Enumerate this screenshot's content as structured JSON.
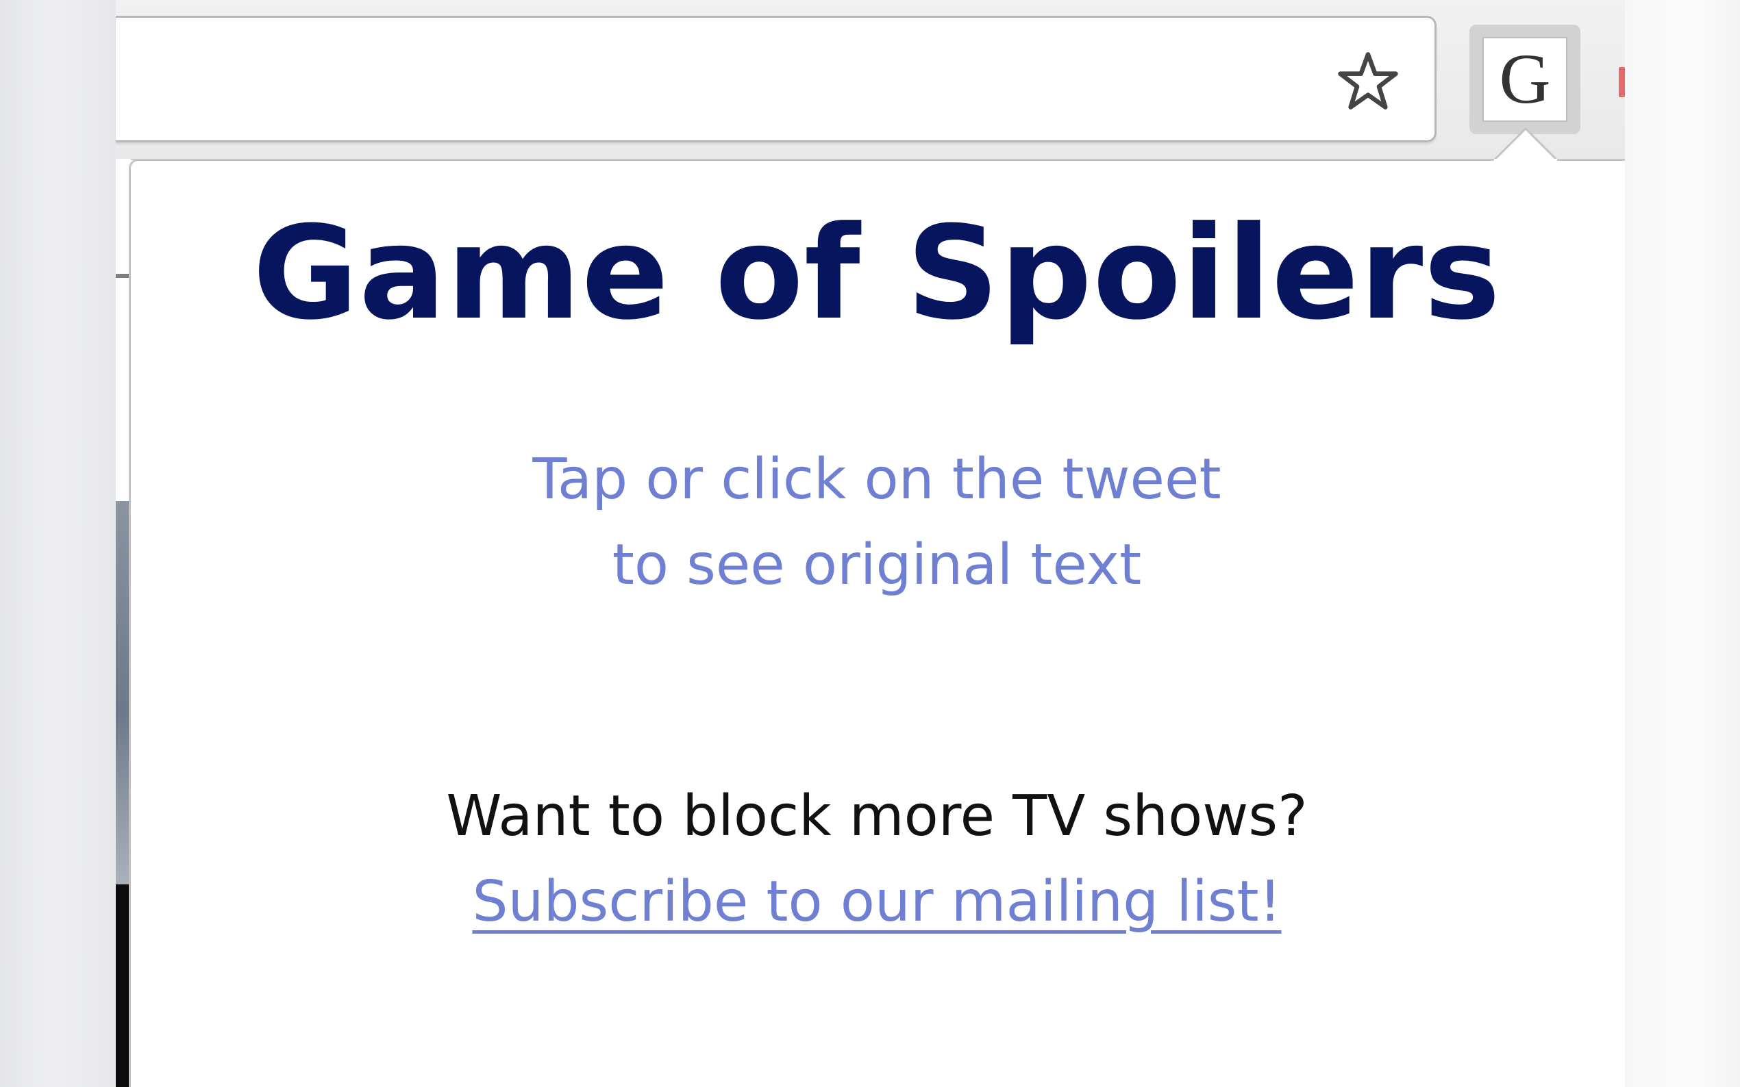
{
  "toolbar": {
    "bookmark_icon": "star-icon",
    "extension_icon_letter": "G"
  },
  "popup": {
    "title": "Game of Spoilers",
    "instructions": {
      "line1": "Tap or click on the tweet",
      "line2": "to see original text"
    },
    "promo": {
      "question": "Want to block more TV shows?",
      "link": "Subscribe to our mailing list!"
    }
  },
  "colors": {
    "title": "#07155e",
    "accent": "#6f7fd2",
    "text": "#111111"
  }
}
